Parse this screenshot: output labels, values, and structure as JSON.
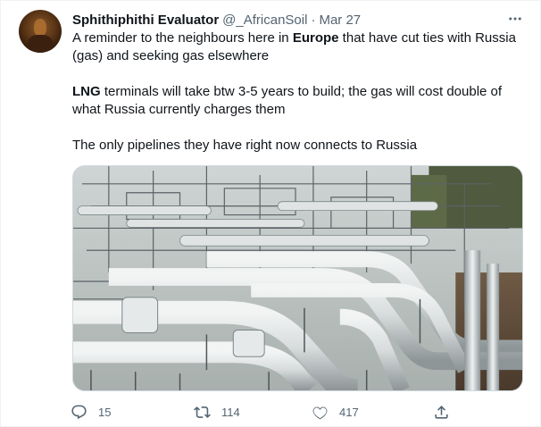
{
  "tweet": {
    "author": {
      "display_name": "Sphithiphithi Evaluator",
      "handle": "@_AfricanSoil",
      "separator": "·",
      "date": "Mar 27"
    },
    "paragraphs": [
      [
        {
          "text": "A reminder to the neighbours here in ",
          "bold": false
        },
        {
          "text": "Europe",
          "bold": true
        },
        {
          "text": " that have cut ties with Russia (gas) and seeking gas elsewhere",
          "bold": false
        }
      ],
      [
        {
          "text": "LNG",
          "bold": true
        },
        {
          "text": " terminals will take btw 3-5 years to build; the gas will cost double of what Russia currently charges them",
          "bold": false
        }
      ],
      [
        {
          "text": "The only pipelines they have right now connects to Russia",
          "bold": false
        }
      ]
    ],
    "media": {
      "icon": "photo-of-gas-pipelines"
    },
    "actions": {
      "reply": {
        "icon": "reply-icon",
        "count": "15"
      },
      "retweet": {
        "icon": "retweet-icon",
        "count": "114"
      },
      "like": {
        "icon": "heart-icon",
        "count": "417"
      },
      "share": {
        "icon": "share-icon"
      }
    },
    "more_icon": "more-horizontal-icon"
  }
}
